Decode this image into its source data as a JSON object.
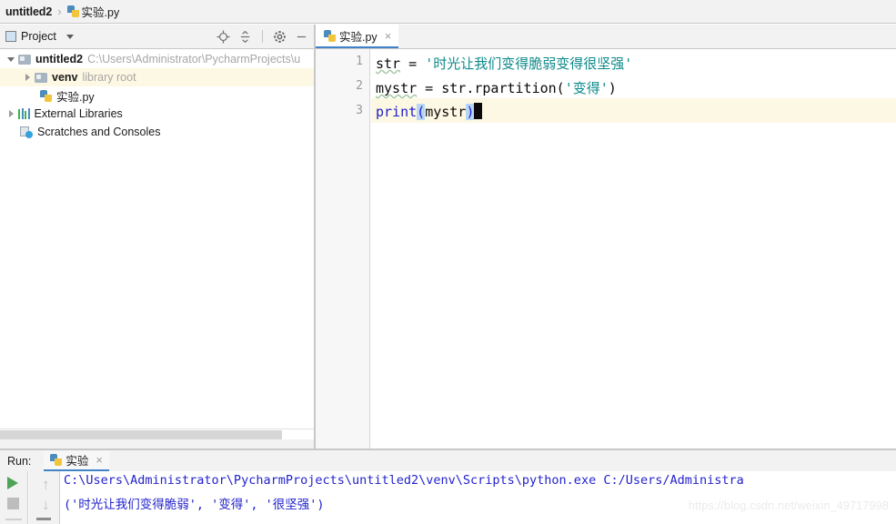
{
  "breadcrumb": {
    "project": "untitled2",
    "separator": "›",
    "file": "实验.py",
    "file_icon": "python-file-icon"
  },
  "project_panel": {
    "title": "Project",
    "caret": "chevron-down-icon",
    "toolbar_icons": [
      {
        "name": "locate-target-icon",
        "glyph": "⨀"
      },
      {
        "name": "collapse-all-icon",
        "glyph": "≡"
      },
      {
        "name": "gear-icon",
        "glyph": "⚙"
      },
      {
        "name": "minimize-icon",
        "glyph": "—"
      }
    ],
    "tree": [
      {
        "label": "untitled2",
        "detail": "C:\\Users\\Administrator\\PycharmProjects\\u",
        "icon": "folder-icon",
        "arrow": "expanded",
        "indent": 1,
        "bold": true,
        "highlight": false
      },
      {
        "label": "venv",
        "detail": "library root",
        "icon": "folder-icon",
        "arrow": "collapsed",
        "indent": 2,
        "bold": true,
        "highlight": true
      },
      {
        "label": "实验.py",
        "detail": "",
        "icon": "python-file-icon",
        "arrow": "none",
        "indent": 3,
        "bold": false,
        "highlight": false
      },
      {
        "label": "External Libraries",
        "detail": "",
        "icon": "libraries-icon",
        "arrow": "collapsed",
        "indent": 1,
        "bold": false,
        "highlight": false
      },
      {
        "label": "Scratches and Consoles",
        "detail": "",
        "icon": "scratches-icon",
        "arrow": "none",
        "indent": 2,
        "bold": false,
        "highlight": false
      }
    ]
  },
  "editor": {
    "tab": {
      "label": "实验.py",
      "icon": "python-file-icon",
      "close": "×"
    },
    "current_line": 3,
    "lines": [
      {
        "number": "1",
        "text": "str = '时光让我们变得脆弱变得很坚强'"
      },
      {
        "number": "2",
        "text": "mystr = str.rpartition('变得')"
      },
      {
        "number": "3",
        "text": "print(mystr)"
      }
    ],
    "tokens": {
      "l1_name": "str",
      "l1_eq": " = ",
      "l1_str": "'时光让我们变得脆弱变得很坚强'",
      "l2_name": "mystr",
      "l2_eq": " = ",
      "l2_call": "str.rpartition(",
      "l2_str": "'变得'",
      "l2_close": ")",
      "l3_fn": "print",
      "l3_open": "(",
      "l3_arg": "mystr",
      "l3_close": ")"
    },
    "colors": {
      "string": "#0e8a8a",
      "function": "#2020c8",
      "plain": "#0a0a0a",
      "current_line_bg": "#fdf8e3",
      "bracket_match_bg": "#b8d7f5"
    }
  },
  "run_panel": {
    "label": "Run:",
    "tab": {
      "label": "实验",
      "icon": "python-file-icon",
      "close": "×"
    },
    "controls": [
      {
        "name": "rerun-button",
        "glyph": "▶"
      },
      {
        "name": "stop-button",
        "glyph": "■"
      },
      {
        "name": "scroll-up-button",
        "glyph": "↑"
      },
      {
        "name": "scroll-down-button",
        "glyph": "↓"
      }
    ],
    "console_lines": [
      "C:\\Users\\Administrator\\PycharmProjects\\untitled2\\venv\\Scripts\\python.exe C:/Users/Administra",
      "('时光让我们变得脆弱', '变得', '很坚强')"
    ],
    "console_color": "#2222cc"
  },
  "watermark": "https://blog.csdn.net/weixin_49717998"
}
